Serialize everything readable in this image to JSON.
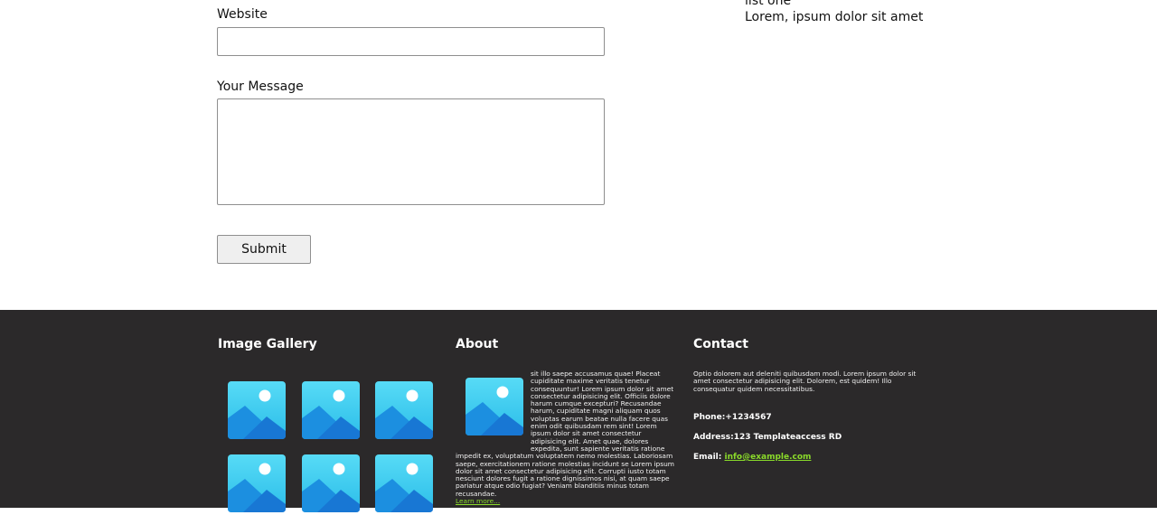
{
  "form": {
    "website_label": "Website",
    "website_value": "",
    "message_label": "Your Message",
    "message_value": "",
    "submit_label": "Submit"
  },
  "side_list": {
    "items": [
      "list one",
      "Lorem, ipsum dolor sit amet"
    ]
  },
  "footer": {
    "gallery": {
      "title": "Image Gallery",
      "images": [
        "image-icon",
        "image-icon",
        "image-icon",
        "image-icon",
        "image-icon",
        "image-icon"
      ]
    },
    "about": {
      "title": "About",
      "image": "image-icon",
      "text": "sit illo saepe accusamus quae! Placeat cupiditate maxime veritatis tenetur consequuntur! Lorem ipsum dolor sit amet consectetur adipisicing elit. Officiis dolore harum cumque excepturi? Recusandae harum, cupiditate magni aliquam quos voluptas earum beatae nulla facere quas enim odit quibusdam rem sint! Lorem ipsum dolor sit amet consectetur adipisicing elit. Amet quae, dolores expedita, sunt sapiente veritatis ratione impedit ex, voluptatum voluptatem nemo molestias. Laboriosam saepe, exercitationem ratione molestias incidunt se Lorem ipsum dolor sit amet consectetur adipisicing elit. Corrupti iusto totam nesciunt dolores fugit a ratione dignissimos nisi, at quam saepe pariatur atque odio fugiat? Veniam blanditiis minus totam recusandae.",
      "learn_more": "Learn more..."
    },
    "contact": {
      "title": "Contact",
      "blurb": "Optio dolorem aut deleniti quibusdam modi. Lorem ipsum dolor sit amet consectetur adipisicing elit. Dolorem, est quidem! Illo consequatur quidem necessitatibus.",
      "phone_label": "Phone:",
      "phone_value": "+1234567",
      "address_label": "Address:",
      "address_value": "123 Templateaccess RD",
      "email_label": "Email: ",
      "email_value": "info@example.com"
    }
  },
  "colors": {
    "footer_bg": "#2b292a",
    "link_green": "#8bdc2a",
    "image_icon_blue": "#1e9ae6"
  }
}
